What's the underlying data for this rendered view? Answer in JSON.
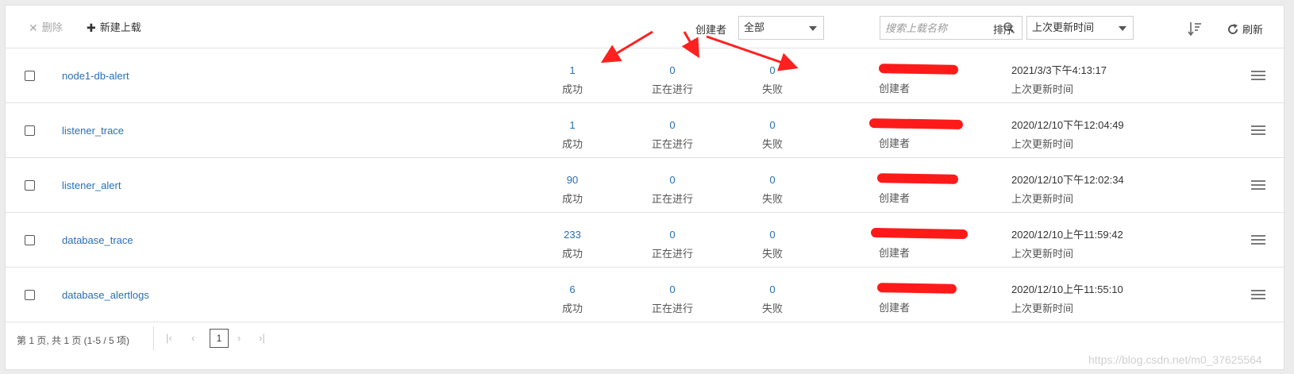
{
  "toolbar": {
    "delete_label": "删除",
    "new_upload_label": "新建上载",
    "creator_filter_label": "创建者",
    "creator_filter_value": "全部",
    "search_placeholder": "搜索上载名称",
    "sort_label": "排序",
    "sort_value": "上次更新时间",
    "refresh_label": "刷新"
  },
  "labels": {
    "success": "成功",
    "in_progress": "正在进行",
    "failed": "失败",
    "creator": "创建者",
    "last_updated": "上次更新时间"
  },
  "rows": [
    {
      "name": "node1-db-alert",
      "success": "1",
      "in_progress": "0",
      "failed": "0",
      "updated": "2021/3/3下午4:13:17"
    },
    {
      "name": "listener_trace",
      "success": "1",
      "in_progress": "0",
      "failed": "0",
      "updated": "2020/12/10下午12:04:49"
    },
    {
      "name": "listener_alert",
      "success": "90",
      "in_progress": "0",
      "failed": "0",
      "updated": "2020/12/10下午12:02:34"
    },
    {
      "name": "database_trace",
      "success": "233",
      "in_progress": "0",
      "failed": "0",
      "updated": "2020/12/10上午11:59:42"
    },
    {
      "name": "database_alertlogs",
      "success": "6",
      "in_progress": "0",
      "failed": "0",
      "updated": "2020/12/10上午11:55:10"
    }
  ],
  "pagination": {
    "info": "第  1  页, 共 1 页  (1-5 / 5 项)",
    "current_page": "1"
  },
  "watermark": "https://blog.csdn.net/m0_37625564",
  "colors": {
    "link": "#2a6eb5",
    "redaction": "#ff1a1a",
    "annotation_arrow": "#ff2020"
  }
}
